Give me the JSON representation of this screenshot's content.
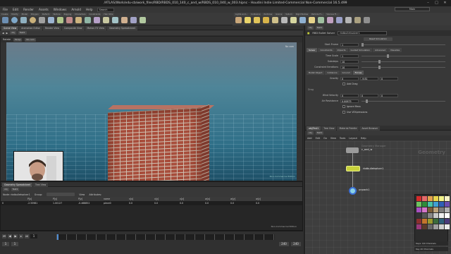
{
  "window": {
    "title": "/ATLAS/Work/edu-cb/work_files/RBD/RBDS_010_140_c_and_w/RBDS_010_040_w_003.hipnc - Houdini Indie Limited-Commercial Non-Commercial 16.5.499",
    "controls": [
      "–",
      "□",
      "✕"
    ]
  },
  "menu": {
    "items": [
      "File",
      "Edit",
      "Render",
      "Assets",
      "Windows",
      "Arnold",
      "Help"
    ],
    "search_placeholder": "Search",
    "desktop": "Main"
  },
  "shelf": {
    "tabs": [
      "Create",
      "Modify",
      "Model",
      "Polygon",
      "Deform",
      "Texture",
      "Rigging",
      "Characters",
      "Constraints",
      "Hair Utils",
      "Guide Process",
      "Guide Brushes",
      "Terrain FX"
    ],
    "right_tabs": [
      "Lights and...",
      "Collisions",
      "Particles",
      "Grains",
      "Vellum",
      "Rigid Bodies",
      "Particle Fl...",
      "Viscous Fl...",
      "Oceans",
      "Fluid Con...",
      "Populate C...",
      "Container...",
      "Pyro FX",
      "FEM",
      "Wires",
      "Crowds",
      "Drive Sim..."
    ]
  },
  "viewport": {
    "tabs": [
      "Scene View",
      "Animation Editor",
      "Render View",
      "Composite View",
      "Motion FX View",
      "Geometry Spreadsheet"
    ],
    "path": [
      "obj",
      "Test1"
    ],
    "toolbar": [
      "Persp",
      "No cam"
    ],
    "state": "Rotate",
    "status": "Non-Commercial Edition"
  },
  "spreadsheet": {
    "tabs": [
      "Geometry Spreadsheet",
      "Tree View"
    ],
    "path": [
      "obj",
      "Test1"
    ],
    "node": "Node: rbdbulletsolver1",
    "group_label": "Group:",
    "view_label": "View",
    "attributes_label": "Attributes:",
    "columns": [
      "",
      "P[x]",
      "P[y]",
      "P[z]",
      "name",
      "v[x]",
      "v[y]",
      "v[z]",
      "w[x]",
      "w[y]",
      "w[z]"
    ],
    "rows": [
      [
        "0",
        "-2.55981",
        "1.00127",
        "-0.468852",
        "piece0",
        "0.0",
        "0.0",
        "0.0",
        "0.0",
        "0.0",
        "0.0"
      ]
    ],
    "footer": "Non-Commercial Edition"
  },
  "timeline": {
    "frame": "1",
    "start": "1",
    "end": "240",
    "end2": "240"
  },
  "params": {
    "header": "RBD Bullet Solver",
    "node_name": "rbdbulletsolver1",
    "reset_button": "Reset Simulation",
    "start_frame": {
      "label": "Start Frame",
      "value": "1"
    },
    "tabs": [
      "Solver",
      "Constraints",
      "Impacts",
      "Guided Simulation",
      "Advanced",
      "Visualize"
    ],
    "time_scale": {
      "label": "Time Scale",
      "value": "1"
    },
    "substeps": {
      "label": "Substeps",
      "value": "10"
    },
    "constraint_iter": {
      "label": "Constraint Iterations",
      "value": "10"
    },
    "subtabs": [
      "Bullet Object",
      "Collisions",
      "Ground",
      "Forces"
    ],
    "gravity": {
      "label": "Gravity",
      "values": [
        "0",
        "-9.81",
        "0"
      ]
    },
    "add_drag": "Add Drag",
    "drag_section": "Drag",
    "wind_velocity": {
      "label": "Wind Velocity",
      "values": [
        "0",
        "0",
        "0"
      ]
    },
    "air_resistance": {
      "label": "Air Resistance",
      "value": "0.00875"
    },
    "ignore_mass": "Ignore Mass",
    "use_vex": "Use VEXpressions"
  },
  "network": {
    "tabs": [
      "obj/Test1",
      "Tree View",
      "Material Palette",
      "Asset Browser"
    ],
    "path": [
      "obj",
      "Test1"
    ],
    "menu": [
      "Add",
      "Edit",
      "Go",
      "View",
      "Tools",
      "Layout",
      "Help"
    ],
    "watermark": "Geometry",
    "nodes": [
      {
        "name": "c_and_w",
        "extra": "Geometry Manager",
        "color": "#9b9b9b"
      },
      {
        "name": "rbdbulletsolver1",
        "extra": "",
        "color": "#c7d13b"
      },
      {
        "name": "unpack1",
        "extra": "",
        "color": "#8bd3e6"
      }
    ],
    "palette": [
      "#d52b2b",
      "#e66a6a",
      "#e3a14d",
      "#e8d54d",
      "#f2f28a",
      "#f7f2c6",
      "#6ec35f",
      "#2f8c3a",
      "#48c2a6",
      "#3fa0d3",
      "#2f5fb6",
      "#6c4db0",
      "#a84fc0",
      "#d675c9",
      "#7a5b38",
      "#bba27a",
      "#7d7d7d",
      "#b0b0b0",
      "#333333",
      "#555555",
      "#888888",
      "#c9c9c9",
      "#efefef",
      "#ffffff",
      "#8c2f2f",
      "#c4742c",
      "#9a9a2e",
      "#3b6b3b",
      "#2e5f7a",
      "#4a3a7a",
      "#9a3a7a",
      "#5a3a2a",
      "#686868",
      "#9e9e9e",
      "#cfcfcf",
      "#e9e9e9"
    ],
    "buttons": [
      "Keys: 0/0 Channels",
      "Key All Channels"
    ]
  }
}
